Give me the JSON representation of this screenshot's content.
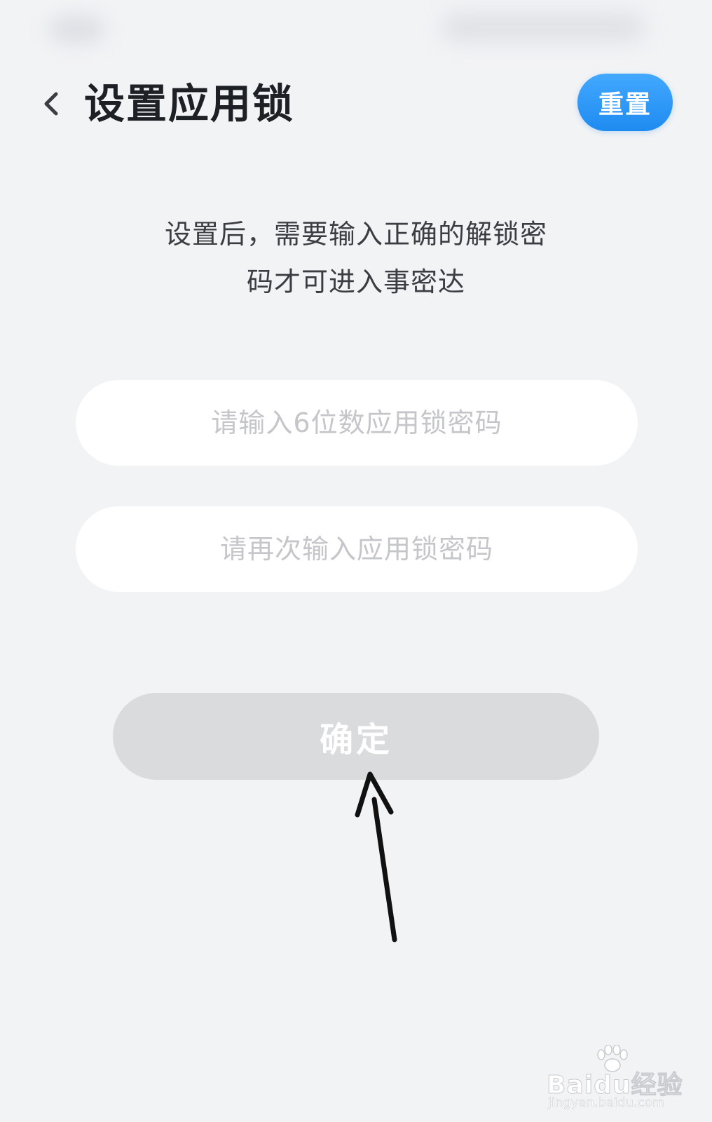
{
  "header": {
    "title": "设置应用锁",
    "reset_label": "重置"
  },
  "description": {
    "line1": "设置后，需要输入正确的解锁密",
    "line2": "码才可进入事密达"
  },
  "form": {
    "password_placeholder": "请输入6位数应用锁密码",
    "password_value": "",
    "confirm_placeholder": "请再次输入应用锁密码",
    "confirm_value": "",
    "submit_label": "确定"
  },
  "watermark": {
    "brand": "Baidu经验",
    "url": "jingyan.baidu.com"
  },
  "colors": {
    "accent": "#2b97f7",
    "background": "#f2f3f5",
    "disabled_button": "#dadbdd",
    "placeholder": "#c4c6ca"
  },
  "icons": {
    "back": "chevron-left-icon",
    "annotation": "arrow-up-icon",
    "watermark": "paw-icon"
  }
}
